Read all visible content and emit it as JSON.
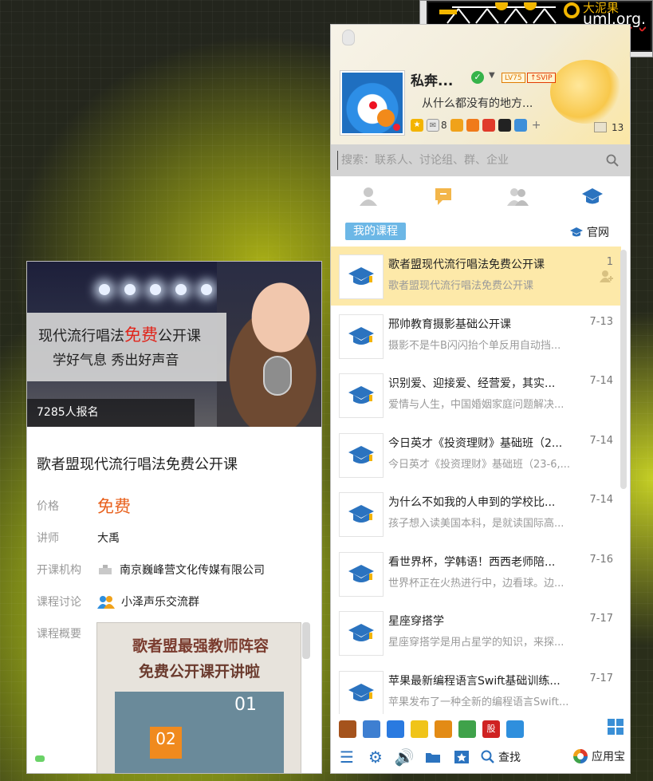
{
  "corner_ad": {
    "line1": "大泥果",
    "line2": "uml.org."
  },
  "qq": {
    "nickname": "私奔...",
    "level_badge": "LV75",
    "svip_badge": "↑SVIP",
    "signature": "从什么都没有的地方...",
    "mail_count": "8",
    "msg_count": "13",
    "search_placeholder": "搜索：联系人、讨论组、群、企业",
    "tabs": [
      "contacts",
      "messages",
      "groups",
      "courses"
    ],
    "my_courses_label": "我的课程",
    "official_site_label": "官网",
    "courses": [
      {
        "title": "歌者盟现代流行唱法免费公开课",
        "date": "1",
        "sub": "歌者盟现代流行唱法免费公开课",
        "selected": true
      },
      {
        "title": "邢帅教育摄影基础公开课",
        "date": "7-13",
        "sub": "摄影不是牛B闪闪抬个单反用自动挡...",
        "selected": false
      },
      {
        "title": "识别爱、迎接爱、经营爱，其实...",
        "date": "7-14",
        "sub": "爱情与人生，中国婚姻家庭问题解决...",
        "selected": false
      },
      {
        "title": "今日英才《投资理财》基础班（2...",
        "date": "7-14",
        "sub": "今日英才《投资理财》基础班（23-6,...",
        "selected": false
      },
      {
        "title": "为什么不如我的人申到的学校比...",
        "date": "7-14",
        "sub": "孩子想入读美国本科，是就读国际高...",
        "selected": false
      },
      {
        "title": "看世界杯，学韩语！西西老师陪...",
        "date": "7-16",
        "sub": "世界杯正在火热进行中，边看球。边...",
        "selected": false
      },
      {
        "title": "星座穿搭学",
        "date": "7-17",
        "sub": "星座穿搭学是用占星学的知识，来探...",
        "selected": false
      },
      {
        "title": "苹果最新编程语言Swift基础训练...",
        "date": "7-17",
        "sub": "苹果发布了一种全新的编程语言Swift...",
        "selected": false
      }
    ],
    "tray_apps": [
      {
        "name": "book-app-icon",
        "color": "#a5531c"
      },
      {
        "name": "penguin-game-icon",
        "color": "#3e7fd1"
      },
      {
        "name": "shield-app-icon",
        "color": "#2a7ae0"
      },
      {
        "name": "notes-app-icon",
        "color": "#f0c419"
      },
      {
        "name": "music-app-icon",
        "color": "#e38b15"
      },
      {
        "name": "browser-app-icon",
        "color": "#3fa24a"
      },
      {
        "name": "stock-app-icon",
        "color": "#cf2222",
        "text": "股"
      },
      {
        "name": "cloud-app-icon",
        "color": "#2f8fdd"
      }
    ],
    "bottom_find_label": "查找",
    "bottom_appstore_label": "应用宝"
  },
  "course_detail": {
    "banner_line1_pre": "现代流行唱法",
    "banner_line1_hot": "免费",
    "banner_line1_post": "公开课",
    "banner_line2": "学好气息 秀出好声音",
    "enroll_text": "7285人报名",
    "title": "歌者盟现代流行唱法免费公开课",
    "rows": [
      {
        "label": "价格",
        "value": "免费"
      },
      {
        "label": "讲师",
        "value": "大禹"
      },
      {
        "label": "开课机构",
        "value": "南京巍峰营文化传媒有限公司"
      },
      {
        "label": "课程讨论",
        "value": "小泽声乐交流群"
      },
      {
        "label": "课程概要",
        "value": ""
      }
    ],
    "summary_title1": "歌者盟最强教师阵容",
    "summary_title2": "免费公开课开讲啦",
    "summary_badge1": "01",
    "summary_badge2": "02"
  },
  "colors": {
    "accent_blue": "#2b73bf",
    "price_orange": "#e8601c",
    "selected_row": "#fde9a9",
    "my_courses_tab": "#6cb7e6"
  }
}
